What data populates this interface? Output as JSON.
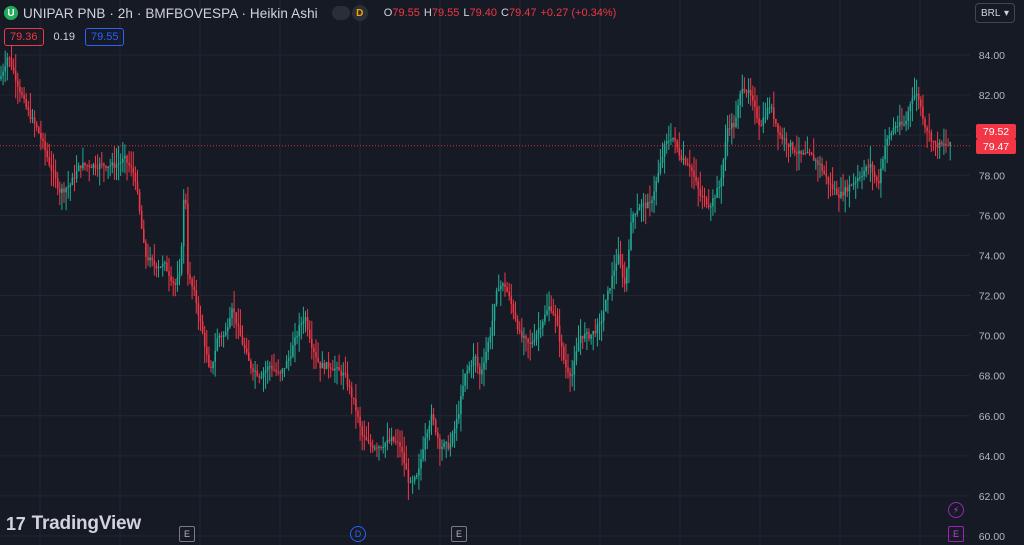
{
  "header": {
    "logo_letter": "U",
    "title": "UNIPAR PNB · 2h · BMFBOVESPA · Heikin Ashi",
    "badge_letter": "D",
    "ohlc": [
      {
        "key": "O",
        "value": "79.55"
      },
      {
        "key": "H",
        "value": "79.55"
      },
      {
        "key": "L",
        "value": "79.40"
      },
      {
        "key": "C",
        "value": "79.47"
      }
    ],
    "change": "+0.27 (+0.34%)"
  },
  "quote": {
    "bid": "79.36",
    "spread": "0.19",
    "ask": "79.55"
  },
  "currency_button": {
    "label": "BRL",
    "arrow": "▾"
  },
  "brand": {
    "mark": "17",
    "name": "TradingView"
  },
  "price_tags": {
    "high_tag": "79.52",
    "last_tag": "79.47"
  },
  "events": [
    {
      "kind": "e",
      "label": "E"
    },
    {
      "kind": "d",
      "label": "D"
    },
    {
      "kind": "e",
      "label": "E"
    },
    {
      "kind": "pe",
      "label": "E"
    },
    {
      "kind": "flash",
      "label": "⚡"
    }
  ],
  "colors": {
    "up": "#22ab94",
    "down": "#f23645",
    "background": "#161a25",
    "grid": "#232632",
    "accent": "#2962ff"
  },
  "chart_data": {
    "type": "candlestick",
    "style": "Heikin Ashi",
    "interval": "2h",
    "currency": "BRL",
    "ylim": [
      60,
      85
    ],
    "yticks": [
      "84.00",
      "82.00",
      "80.00",
      "78.00",
      "76.00",
      "74.00",
      "72.00",
      "70.00",
      "68.00",
      "66.00",
      "64.00",
      "62.00",
      "60.00"
    ],
    "grid": true,
    "last_price": 79.47,
    "path": [
      [
        0,
        82.8
      ],
      [
        8,
        84.0
      ],
      [
        25,
        81.5
      ],
      [
        40,
        80.0
      ],
      [
        50,
        78.5
      ],
      [
        60,
        77.2
      ],
      [
        70,
        77.5
      ],
      [
        80,
        78.5
      ],
      [
        100,
        78.5
      ],
      [
        115,
        78.5
      ],
      [
        125,
        78.8
      ],
      [
        135,
        78.0
      ],
      [
        145,
        74.0
      ],
      [
        155,
        73.5
      ],
      [
        165,
        73.5
      ],
      [
        175,
        72.5
      ],
      [
        180,
        73.0
      ],
      [
        185,
        78.0
      ],
      [
        188,
        73.0
      ],
      [
        195,
        72.0
      ],
      [
        205,
        69.5
      ],
      [
        210,
        68.0
      ],
      [
        218,
        70.0
      ],
      [
        225,
        70.0
      ],
      [
        232,
        71.5
      ],
      [
        240,
        70.0
      ],
      [
        250,
        68.5
      ],
      [
        260,
        68.0
      ],
      [
        270,
        68.5
      ],
      [
        280,
        68.0
      ],
      [
        290,
        69.0
      ],
      [
        300,
        70.5
      ],
      [
        305,
        71.0
      ],
      [
        312,
        69.5
      ],
      [
        320,
        68.5
      ],
      [
        330,
        68.5
      ],
      [
        345,
        68.0
      ],
      [
        355,
        66.5
      ],
      [
        362,
        65.0
      ],
      [
        370,
        64.5
      ],
      [
        380,
        64.5
      ],
      [
        392,
        64.8
      ],
      [
        400,
        64.5
      ],
      [
        410,
        62.5
      ],
      [
        418,
        63.0
      ],
      [
        425,
        65.0
      ],
      [
        432,
        66.0
      ],
      [
        440,
        64.5
      ],
      [
        450,
        64.5
      ],
      [
        458,
        66.0
      ],
      [
        465,
        68.0
      ],
      [
        475,
        69.0
      ],
      [
        480,
        68.0
      ],
      [
        490,
        70.0
      ],
      [
        498,
        72.5
      ],
      [
        505,
        72.5
      ],
      [
        515,
        71.0
      ],
      [
        520,
        70.0
      ],
      [
        530,
        69.5
      ],
      [
        540,
        70.5
      ],
      [
        550,
        71.5
      ],
      [
        555,
        71.0
      ],
      [
        565,
        68.5
      ],
      [
        572,
        68.0
      ],
      [
        580,
        70.0
      ],
      [
        590,
        70.0
      ],
      [
        600,
        70.5
      ],
      [
        610,
        72.5
      ],
      [
        618,
        74.0
      ],
      [
        625,
        72.5
      ],
      [
        632,
        76.0
      ],
      [
        640,
        76.5
      ],
      [
        650,
        76.5
      ],
      [
        658,
        78.0
      ],
      [
        665,
        79.5
      ],
      [
        672,
        80.0
      ],
      [
        680,
        79.0
      ],
      [
        690,
        78.5
      ],
      [
        700,
        77.0
      ],
      [
        710,
        76.5
      ],
      [
        720,
        77.5
      ],
      [
        728,
        80.5
      ],
      [
        735,
        80.5
      ],
      [
        742,
        82.5
      ],
      [
        750,
        82.0
      ],
      [
        760,
        80.5
      ],
      [
        770,
        81.5
      ],
      [
        780,
        80.0
      ],
      [
        790,
        79.5
      ],
      [
        800,
        79.0
      ],
      [
        810,
        79.0
      ],
      [
        820,
        78.5
      ],
      [
        830,
        77.5
      ],
      [
        840,
        77.0
      ],
      [
        850,
        77.5
      ],
      [
        860,
        78.0
      ],
      [
        870,
        78.5
      ],
      [
        878,
        77.5
      ],
      [
        885,
        79.5
      ],
      [
        895,
        80.5
      ],
      [
        905,
        80.5
      ],
      [
        912,
        82.0
      ],
      [
        918,
        82.0
      ],
      [
        925,
        80.5
      ],
      [
        935,
        79.5
      ],
      [
        945,
        79.5
      ],
      [
        952,
        79.47
      ]
    ]
  }
}
